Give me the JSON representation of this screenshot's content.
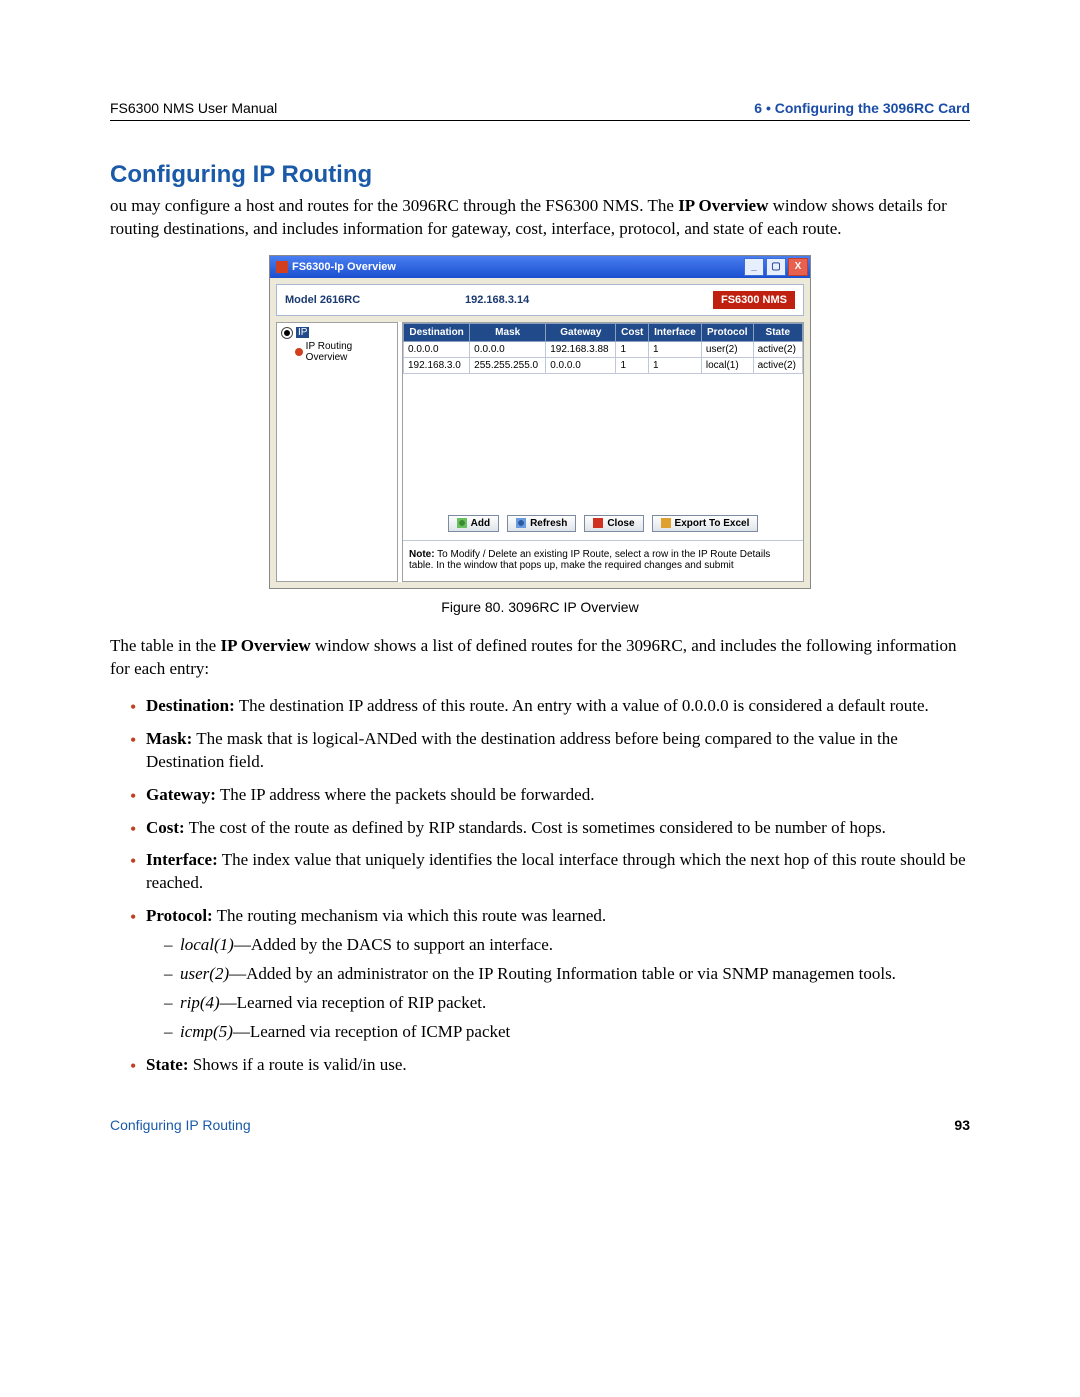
{
  "header": {
    "left": "FS6300 NMS User Manual",
    "right": "6 • Configuring the 3096RC Card"
  },
  "section_title": "Configuring IP Routing",
  "intro_html": "ou may configure a host and routes for the 3096RC through the FS6300 NMS. The <b>IP Overview</b> window shows details for routing destinations, and includes information for gateway, cost, interface, protocol, and state of each route.",
  "figure": {
    "window_title": "FS6300-Ip Overview",
    "model_label": "Model 2616RC",
    "ip_address": "192.168.3.14",
    "brand": "FS6300 NMS",
    "tree": {
      "root_label": "IP",
      "child_label": "IP Routing Overview"
    },
    "columns": [
      "Destination",
      "Mask",
      "Gateway",
      "Cost",
      "Interface",
      "Protocol",
      "State"
    ],
    "rows": [
      {
        "destination": "0.0.0.0",
        "mask": "0.0.0.0",
        "gateway": "192.168.3.88",
        "cost": "1",
        "interface": "1",
        "protocol": "user(2)",
        "state": "active(2)"
      },
      {
        "destination": "192.168.3.0",
        "mask": "255.255.255.0",
        "gateway": "0.0.0.0",
        "cost": "1",
        "interface": "1",
        "protocol": "local(1)",
        "state": "active(2)"
      }
    ],
    "buttons": {
      "add": "Add",
      "refresh": "Refresh",
      "close": "Close",
      "export": "Export To Excel"
    },
    "note_html": "<b>Note:</b> To Modify / Delete an existing IP Route, select a row in the IP Route Details table. In the window that pops up, make the required changes and submit",
    "caption": "Figure 80. 3096RC IP Overview"
  },
  "after_figure_html": "The table in the <b>IP Overview</b> window shows a list of defined routes for the 3096RC, and includes the following information for each entry:",
  "bullets": [
    {
      "html": "<b>Destination:</b> The destination IP address of this route. An entry with a value of 0.0.0.0 is considered a default route."
    },
    {
      "html": "<b>Mask:</b> The mask that is logical-ANDed with the destination address before being compared to the value in the Destination field."
    },
    {
      "html": "<b>Gateway:</b> The IP address where the packets should be forwarded."
    },
    {
      "html": "<b>Cost:</b> The cost of the route as defined by RIP standards. Cost is sometimes considered to be number of hops."
    },
    {
      "html": "<b>Interface:</b> The index value that uniquely identifies the local interface through which the next hop of this route should be reached."
    },
    {
      "html": "<b>Protocol:</b> The routing mechanism via which this route was learned.",
      "sub": [
        "<em>local(1)</em>—Added by the DACS to support an interface.",
        "<em>user(2)</em>—Added by an administrator on the IP Routing Information table or via SNMP managemen tools.",
        "<em>rip(4)</em>—Learned via reception of RIP packet.",
        "<em>icmp(5)</em>—Learned via reception of ICMP packet"
      ]
    },
    {
      "html": "<b>State:</b> Shows if a route is valid/in use."
    }
  ],
  "footer": {
    "left": "Configuring IP Routing",
    "right": "93"
  }
}
